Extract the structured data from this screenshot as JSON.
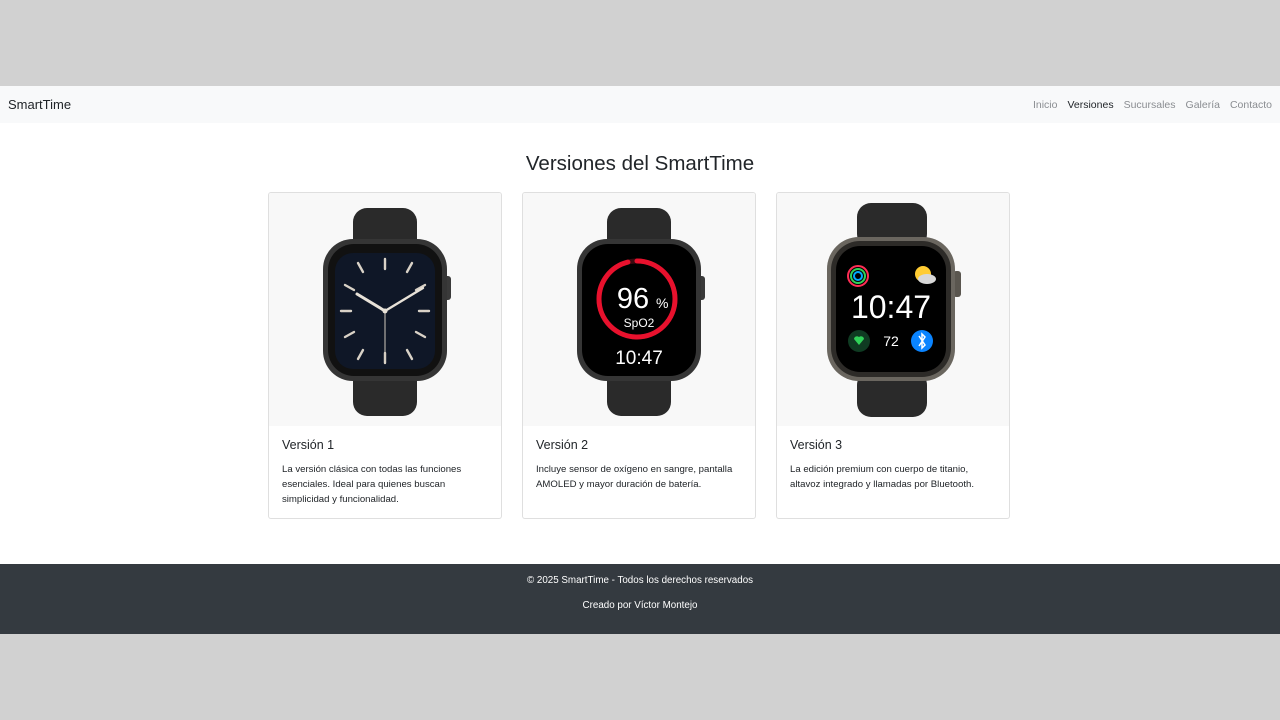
{
  "navbar": {
    "brand": "SmartTime",
    "links": [
      "Inicio",
      "Versiones",
      "Sucursales",
      "Galería",
      "Contacto"
    ],
    "active": "Versiones"
  },
  "page_title": "Versiones del SmartTime",
  "cards": [
    {
      "title": "Versión 1",
      "text": "La versión clásica con todas las funciones esenciales. Ideal para quienes buscan simplicidad y funcionalidad.",
      "image": "analog-watch-face"
    },
    {
      "title": "Versión 2",
      "text": "Incluye sensor de oxígeno en sangre, pantalla AMOLED y mayor duración de batería.",
      "image": "spo2-watch-face",
      "screen": {
        "value": "96",
        "unit": "%",
        "label": "SpO2",
        "time": "10:47",
        "ring_fraction": 0.96
      }
    },
    {
      "title": "Versión 3",
      "text": "La edición premium con cuerpo de titanio, altavoz integrado y llamadas por Bluetooth.",
      "image": "complications-watch-face",
      "screen": {
        "time": "10:47",
        "heart_rate": "72"
      }
    }
  ],
  "footer": {
    "copyright": "© 2025 SmartTime - Todos los derechos reservados",
    "credit": "Creado por Víctor Montejo"
  },
  "colors": {
    "navbar_bg": "#f8f9fa",
    "footer_bg": "#343a40",
    "ring": "#e8112d",
    "bluetooth": "#0a84ff",
    "heart": "#30d158"
  }
}
